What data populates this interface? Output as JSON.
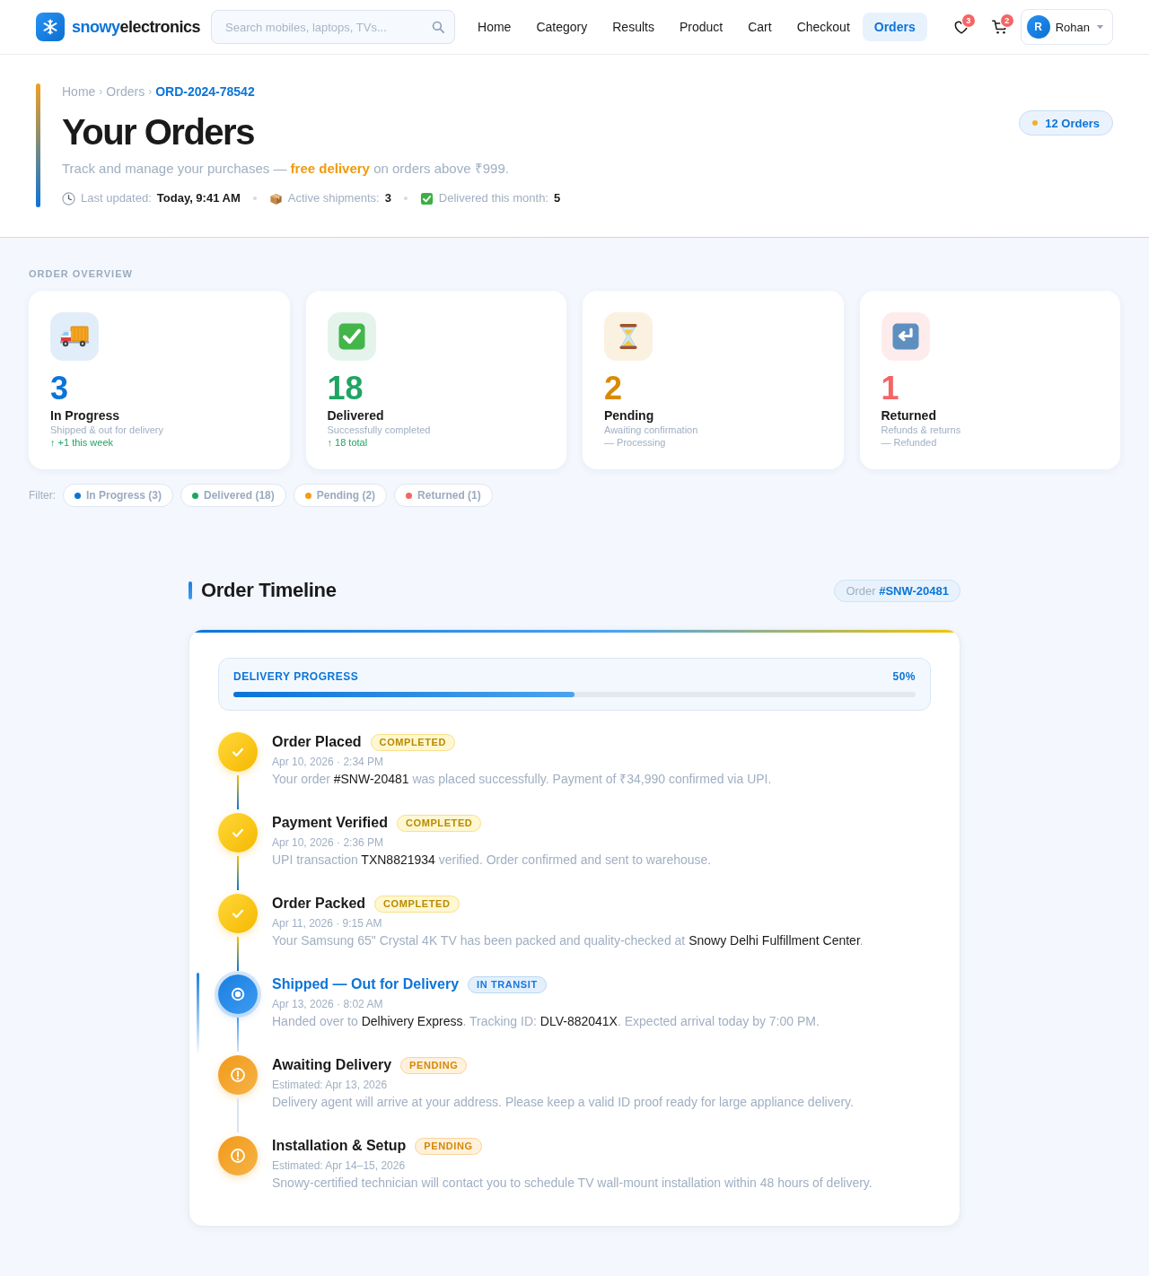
{
  "header": {
    "brand": {
      "accent": "snowy",
      "rest": "electronics"
    },
    "search": {
      "placeholder": "Search mobiles, laptops, TVs..."
    },
    "nav": [
      {
        "label": "Home",
        "selected": false
      },
      {
        "label": "Category",
        "selected": false
      },
      {
        "label": "Results",
        "selected": false
      },
      {
        "label": "Product",
        "selected": false
      },
      {
        "label": "Cart",
        "selected": false
      },
      {
        "label": "Checkout",
        "selected": false
      },
      {
        "label": "Orders",
        "selected": true
      }
    ],
    "wishlist": {
      "count": "3"
    },
    "cart": {
      "count": "2"
    },
    "user": {
      "initial": "R",
      "name": "Rohan"
    }
  },
  "hero": {
    "breadcrumbs": [
      {
        "label": "Home",
        "current": false
      },
      {
        "label": "Orders",
        "current": false
      },
      {
        "label": "ORD-2024-78542",
        "current": true
      }
    ],
    "separator": "›",
    "title": "Your Orders",
    "subtitle": "Track and manage your purchases — **free delivery** on orders above ₹999.",
    "meta": [
      {
        "kind": "updated",
        "label": "Last updated:",
        "value": "Today, 9:41 AM"
      },
      {
        "kind": "shipments",
        "label": "Active shipments:",
        "value": "3"
      },
      {
        "kind": "delivered",
        "label": "Delivered this month:",
        "value": "5"
      }
    ],
    "count_badge": "12 Orders"
  },
  "overview": {
    "heading": "ORDER OVERVIEW",
    "cards": [
      {
        "kind": "in_progress",
        "color": "#0b74d8",
        "value": "3",
        "label": "In Progress",
        "detail": "Shipped & out for delivery",
        "note": "↑ +1 this week",
        "positive": true
      },
      {
        "kind": "delivered",
        "color": "#1fa463",
        "value": "18",
        "label": "Delivered",
        "detail": "Successfully completed",
        "note": "↑ 18 total",
        "positive": true
      },
      {
        "kind": "pending",
        "color": "#d98a04",
        "value": "2",
        "label": "Pending",
        "detail": "Awaiting confirmation",
        "note": "— Processing",
        "positive": false
      },
      {
        "kind": "returned",
        "color": "#f56565",
        "value": "1",
        "label": "Returned",
        "detail": "Refunds & returns",
        "note": "— Refunded",
        "positive": false
      }
    ]
  },
  "filters": {
    "label": "Filter:",
    "chips": [
      {
        "label": "In Progress (3)",
        "color": "#0b74d8",
        "selected": false
      },
      {
        "label": "Delivered (18)",
        "color": "#1fa463",
        "selected": false
      },
      {
        "label": "Pending (2)",
        "color": "#f39c12",
        "selected": false
      },
      {
        "label": "Returned (1)",
        "color": "#f56565",
        "selected": false
      }
    ]
  },
  "timeline": {
    "title": "Order Timeline",
    "order_badge": "Order **#SNW-20481**",
    "progress": {
      "label": "DELIVERY PROGRESS",
      "reading": "50%",
      "level": 0.5
    },
    "steps": [
      {
        "kind": "completed",
        "title": "Order Placed",
        "badge": "COMPLETED",
        "date": "Apr 10, 2026 · 2:34 PM",
        "description": [
          {
            "text": "Your order ",
            "highlight": false
          },
          {
            "text": "#SNW-20481",
            "highlight": true
          },
          {
            "text": " was placed successfully. Payment of ₹34,990 confirmed via UPI.",
            "highlight": false
          }
        ]
      },
      {
        "kind": "completed",
        "title": "Payment Verified",
        "badge": "COMPLETED",
        "date": "Apr 10, 2026 · 2:36 PM",
        "description": [
          {
            "text": "UPI transaction ",
            "highlight": false
          },
          {
            "text": "TXN8821934",
            "highlight": true
          },
          {
            "text": " verified. Order confirmed and sent to warehouse.",
            "highlight": false
          }
        ]
      },
      {
        "kind": "completed",
        "title": "Order Packed",
        "badge": "COMPLETED",
        "date": "Apr 11, 2026 · 9:15 AM",
        "description": [
          {
            "text": "Your Samsung 65\" Crystal 4K TV has been packed and quality-checked at ",
            "highlight": false
          },
          {
            "text": "Snowy Delhi Fulfillment Center",
            "highlight": true
          },
          {
            "text": ".",
            "highlight": false
          }
        ]
      },
      {
        "kind": "current",
        "title": "Shipped — Out for Delivery",
        "badge": "IN TRANSIT",
        "date": "Apr 13, 2026 · 8:02 AM",
        "description": [
          {
            "text": "Handed over to ",
            "highlight": false
          },
          {
            "text": "Delhivery Express",
            "highlight": true
          },
          {
            "text": ". Tracking ID: ",
            "highlight": false
          },
          {
            "text": "DLV-882041X",
            "highlight": true
          },
          {
            "text": ". Expected arrival today by 7:00 PM.",
            "highlight": false
          }
        ]
      },
      {
        "kind": "pending",
        "title": "Awaiting Delivery",
        "badge": "PENDING",
        "date": "Estimated: Apr 13, 2026",
        "description": [
          {
            "text": "Delivery agent will arrive at your address. Please keep a valid ID proof ready for large appliance delivery.",
            "highlight": false
          }
        ]
      },
      {
        "kind": "pending",
        "title": "Installation & Setup",
        "badge": "PENDING",
        "date": "Estimated: Apr 14–15, 2026",
        "description": [
          {
            "text": "Snowy-certified technician will contact you to schedule TV wall-mount installation within 48 hours of delivery.",
            "highlight": false
          }
        ]
      }
    ]
  }
}
